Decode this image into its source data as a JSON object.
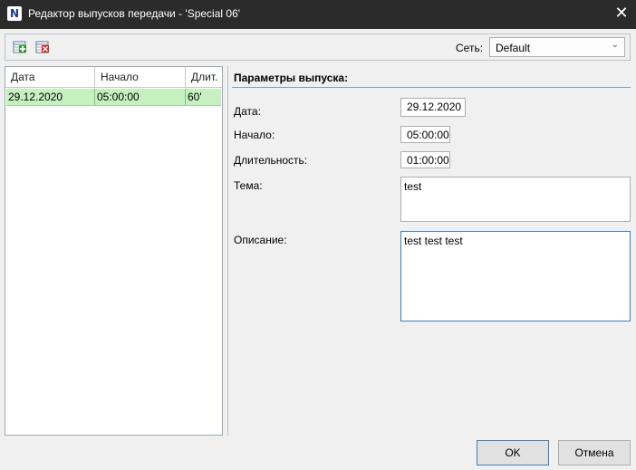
{
  "window": {
    "icon_glyph": "N",
    "title": "Редактор выпусков передачи - 'Special 06'",
    "close_glyph": "✕"
  },
  "toolbar": {
    "network_label": "Сеть:",
    "network_value": "Default",
    "chevron_glyph": "⌄"
  },
  "list": {
    "headers": [
      "Дата",
      "Начало",
      "Длит."
    ],
    "rows": [
      {
        "date": "29.12.2020",
        "start": "05:00:00",
        "duration": "60'"
      }
    ]
  },
  "params": {
    "title": "Параметры выпуска:",
    "date_label": "Дата:",
    "date_value": "29.12.2020",
    "start_label": "Начало:",
    "start_value": "05:00:00",
    "duration_label": "Длительность:",
    "duration_value": "01:00:00",
    "topic_label": "Тема:",
    "topic_value": "test",
    "description_label": "Описание:",
    "description_value": "test test test"
  },
  "buttons": {
    "ok": "OK",
    "cancel": "Отмена"
  },
  "colors": {
    "titlebar": "#2b2b2b",
    "selected_row": "#c6f0c0",
    "section_line": "#7aa0c4"
  }
}
